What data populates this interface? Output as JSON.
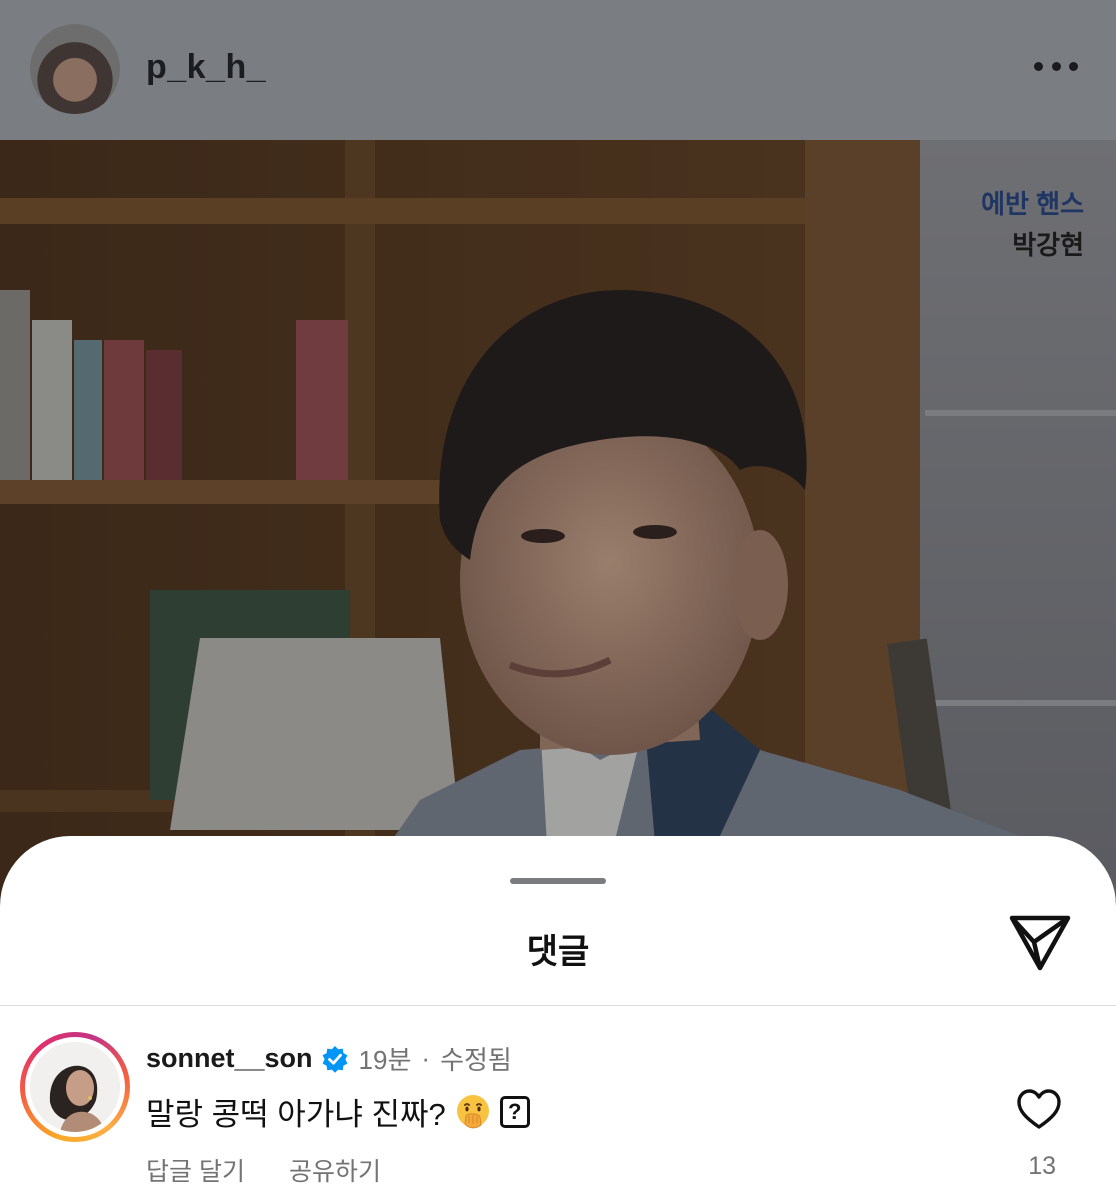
{
  "header": {
    "username": "p_k_h_",
    "more_icon": "more-horizontal-icon"
  },
  "post": {
    "overlay_role": "에반 핸스",
    "overlay_actor": "박강현"
  },
  "comments_sheet": {
    "title": "댓글",
    "share_icon": "paper-plane-icon"
  },
  "comment": {
    "username": "sonnet__son",
    "verified_icon": "verified-badge-icon",
    "time": "19분",
    "separator": "·",
    "edited": "수정됨",
    "text": "말랑 콩떡 아가냐 진짜?",
    "emoji_icon": "face-with-hand-over-mouth-emoji",
    "unknown_glyph": "?",
    "reply_label": "답글 달기",
    "share_label": "공유하기",
    "like_count": "13"
  },
  "colors": {
    "header_bg": "#7a7d82",
    "role_text": "#1f3563",
    "meta_text": "#737373",
    "verified_blue": "#0095f6"
  }
}
